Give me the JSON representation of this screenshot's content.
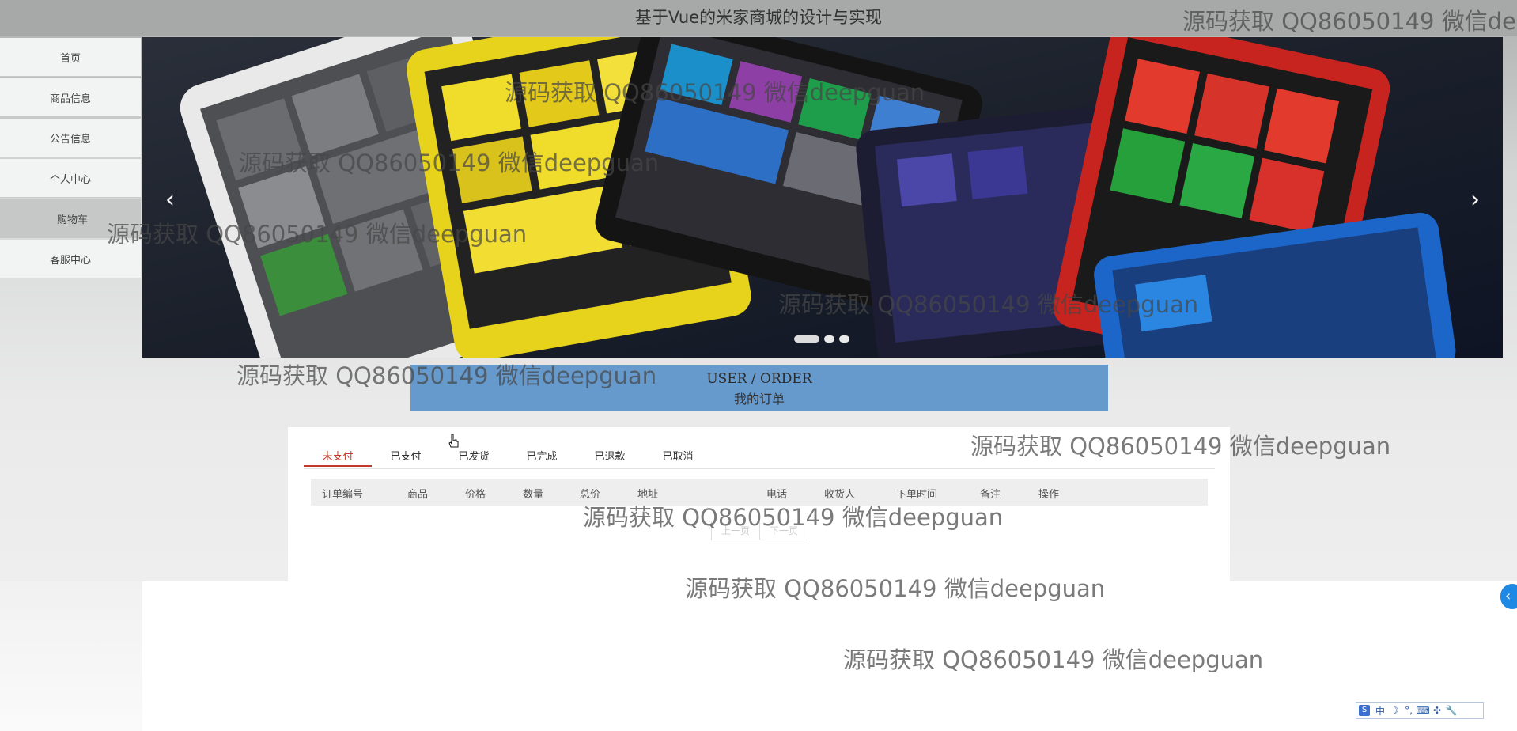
{
  "header": {
    "title": "基于Vue的米家商城的设计与实现"
  },
  "sidebar": {
    "items": [
      {
        "label": "首页"
      },
      {
        "label": "商品信息"
      },
      {
        "label": "公告信息"
      },
      {
        "label": "个人中心"
      },
      {
        "label": "购物车"
      },
      {
        "label": "客服中心"
      }
    ],
    "active_index": 4
  },
  "carousel": {
    "prev_symbol": "‹",
    "next_symbol": "›"
  },
  "order": {
    "banner_en": "USER / ORDER",
    "banner_cn": "我的订单",
    "tabs": [
      {
        "label": "未支付"
      },
      {
        "label": "已支付"
      },
      {
        "label": "已发货"
      },
      {
        "label": "已完成"
      },
      {
        "label": "已退款"
      },
      {
        "label": "已取消"
      }
    ],
    "active_tab": 0,
    "columns": [
      "订单编号",
      "商品",
      "价格",
      "数量",
      "总价",
      "地址",
      "电话",
      "收货人",
      "下单时间",
      "备注",
      "操作"
    ],
    "pager": {
      "prev": "上一页",
      "next": "下一页"
    }
  },
  "watermark": {
    "text": "源码获取 QQ86050149 微信deepguan"
  },
  "ime": {
    "items": [
      "中",
      "☽",
      "°,",
      "⌨",
      "✣",
      "🔧"
    ]
  },
  "colors": {
    "accent_red": "#c0392b",
    "banner_blue": "#6699cc",
    "collapse_blue": "#1e88e5"
  },
  "icons": {
    "side_collapse": "chevron-left-icon",
    "ime_logo": "S"
  }
}
